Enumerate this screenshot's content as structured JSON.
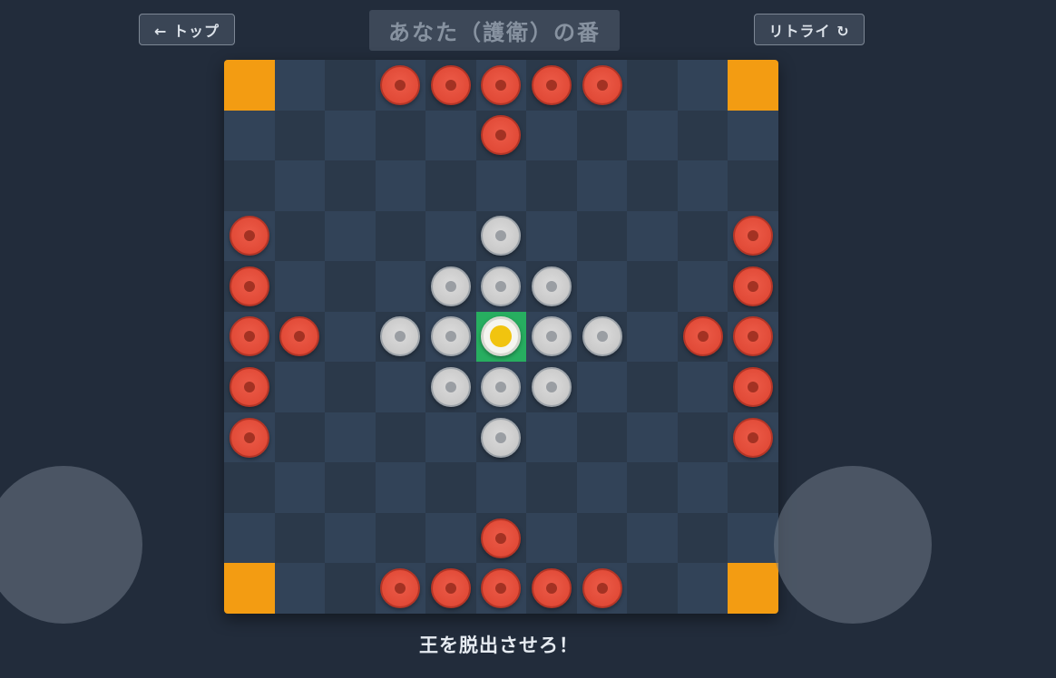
{
  "header": {
    "back_label": "← トップ",
    "turn_label": "あなた（護衛）の番",
    "retry_label": "リトライ ↻"
  },
  "board": {
    "size": 11,
    "corners": [
      [
        0,
        0
      ],
      [
        0,
        10
      ],
      [
        10,
        0
      ],
      [
        10,
        10
      ]
    ],
    "throne": [
      5,
      5
    ],
    "pieces": [
      {
        "row": 0,
        "col": 3,
        "type": "attacker"
      },
      {
        "row": 0,
        "col": 4,
        "type": "attacker"
      },
      {
        "row": 0,
        "col": 5,
        "type": "attacker"
      },
      {
        "row": 0,
        "col": 6,
        "type": "attacker"
      },
      {
        "row": 0,
        "col": 7,
        "type": "attacker"
      },
      {
        "row": 1,
        "col": 5,
        "type": "attacker"
      },
      {
        "row": 3,
        "col": 0,
        "type": "attacker"
      },
      {
        "row": 3,
        "col": 10,
        "type": "attacker"
      },
      {
        "row": 4,
        "col": 0,
        "type": "attacker"
      },
      {
        "row": 4,
        "col": 10,
        "type": "attacker"
      },
      {
        "row": 5,
        "col": 0,
        "type": "attacker"
      },
      {
        "row": 5,
        "col": 1,
        "type": "attacker"
      },
      {
        "row": 5,
        "col": 9,
        "type": "attacker"
      },
      {
        "row": 5,
        "col": 10,
        "type": "attacker"
      },
      {
        "row": 6,
        "col": 0,
        "type": "attacker"
      },
      {
        "row": 6,
        "col": 10,
        "type": "attacker"
      },
      {
        "row": 7,
        "col": 0,
        "type": "attacker"
      },
      {
        "row": 7,
        "col": 10,
        "type": "attacker"
      },
      {
        "row": 9,
        "col": 5,
        "type": "attacker"
      },
      {
        "row": 10,
        "col": 3,
        "type": "attacker"
      },
      {
        "row": 10,
        "col": 4,
        "type": "attacker"
      },
      {
        "row": 10,
        "col": 5,
        "type": "attacker"
      },
      {
        "row": 10,
        "col": 6,
        "type": "attacker"
      },
      {
        "row": 10,
        "col": 7,
        "type": "attacker"
      },
      {
        "row": 3,
        "col": 5,
        "type": "defender"
      },
      {
        "row": 4,
        "col": 4,
        "type": "defender"
      },
      {
        "row": 4,
        "col": 5,
        "type": "defender"
      },
      {
        "row": 4,
        "col": 6,
        "type": "defender"
      },
      {
        "row": 5,
        "col": 3,
        "type": "defender"
      },
      {
        "row": 5,
        "col": 4,
        "type": "defender"
      },
      {
        "row": 5,
        "col": 6,
        "type": "defender"
      },
      {
        "row": 5,
        "col": 7,
        "type": "defender"
      },
      {
        "row": 6,
        "col": 4,
        "type": "defender"
      },
      {
        "row": 6,
        "col": 5,
        "type": "defender"
      },
      {
        "row": 6,
        "col": 6,
        "type": "defender"
      },
      {
        "row": 7,
        "col": 5,
        "type": "defender"
      },
      {
        "row": 5,
        "col": 5,
        "type": "king"
      }
    ]
  },
  "footer": {
    "hint": "王を脱出させろ！"
  },
  "colors": {
    "background": "#222c3b",
    "corner": "#f39c12",
    "throne": "#27ae60",
    "attacker": "#e14a37",
    "defender": "#c8c8c8",
    "king_center": "#f1c40f"
  }
}
